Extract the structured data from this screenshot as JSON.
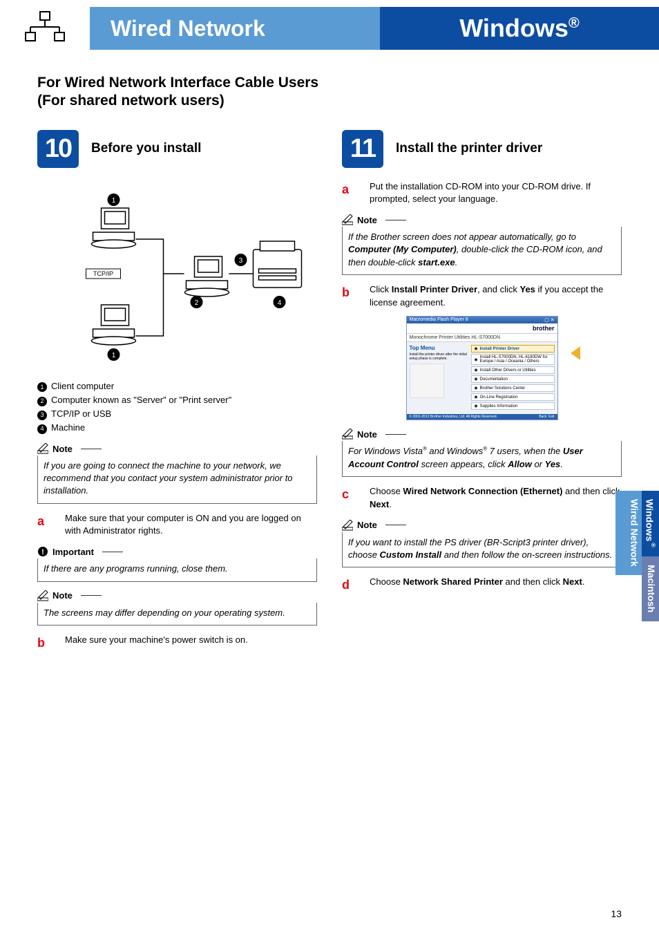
{
  "header": {
    "banner1": "Wired Network",
    "banner2_main": "Windows",
    "banner2_sup": "®"
  },
  "section_title_line1": "For Wired Network Interface Cable Users",
  "section_title_line2": "(For shared network users)",
  "step10": {
    "num": "10",
    "title": "Before you install",
    "diagram_label_tcpip": "TCP/IP",
    "legend": {
      "n1": "1",
      "t1": "Client computer",
      "n2": "2",
      "t2": "Computer known as \"Server\" or \"Print server\"",
      "n3": "3",
      "t3": "TCP/IP or USB",
      "n4": "4",
      "t4": "Machine"
    },
    "note1_label": "Note",
    "note1_body": "If you are going to connect the machine to your network, we recommend that you contact your system administrator prior to installation.",
    "a": "Make sure that your computer is ON and you are logged on with Administrator rights.",
    "important_label": "Important",
    "important_body": "If there are any programs running, close them.",
    "note2_label": "Note",
    "note2_body": "The screens may differ depending on your operating system.",
    "b": "Make sure your machine's power switch is on."
  },
  "step11": {
    "num": "11",
    "title": "Install the printer driver",
    "a": "Put the installation CD-ROM into your CD-ROM drive. If prompted, select your language.",
    "note1_label": "Note",
    "note1_prefix": "If the Brother screen does not appear automatically, go to ",
    "note1_bold1": "Computer (My Computer)",
    "note1_mid": ", double-click the CD-ROM icon, and then double-click ",
    "note1_bold2": "start.exe",
    "note1_suffix": ".",
    "b_pre": "Click ",
    "b_bold1": "Install Printer Driver",
    "b_mid": ", and click ",
    "b_bold2": "Yes",
    "b_post": " if you accept the license agreement.",
    "screenshot": {
      "win_title": "Macromedia Flash Player 8",
      "brand": "brother",
      "product_line": "Monochrome Printer Utilities",
      "model": "HL-S7000DN",
      "top_menu": "Top Menu",
      "left_text": "Install the printer driver after the initial setup phase is complete.",
      "items": [
        "Install Printer Driver",
        "Install HL-S7000DN, HL-6180DW for Europe / Asia / Oceania / Others",
        "Install Other Drivers or Utilities",
        "Documentation",
        "Brother Solutions Center",
        "On-Line Registration",
        "Supplies Information"
      ],
      "footer_left": "© 2001-2012 Brother Industries, Ltd. All Rights Reserved.",
      "footer_back": "Back",
      "footer_exit": "Exit"
    },
    "note2_label": "Note",
    "note2_pre": "For Windows Vista",
    "note2_sup1": "®",
    "note2_mid1": " and Windows",
    "note2_sup2": "®",
    "note2_mid2": " 7 users, when the ",
    "note2_bold1": "User Account Control",
    "note2_mid3": " screen appears, click ",
    "note2_bold2": "Allow",
    "note2_or": " or ",
    "note2_bold3": "Yes",
    "note2_end": ".",
    "c_pre": "Choose ",
    "c_bold1": "Wired Network Connection (Ethernet)",
    "c_mid": " and then click ",
    "c_bold2": "Next",
    "c_end": ".",
    "note3_label": "Note",
    "note3_pre": "If you want to install the PS driver (BR-Script3 printer driver), choose ",
    "note3_bold": "Custom Install",
    "note3_post": " and then follow the on-screen instructions.",
    "d_pre": "Choose ",
    "d_bold1": "Network Shared Printer",
    "d_mid": " and then click ",
    "d_bold2": "Next",
    "d_end": "."
  },
  "sidetabs": {
    "wired": "Wired Network",
    "win": "Windows",
    "win_sup": "®",
    "mac": "Macintosh"
  },
  "page_number": "13"
}
